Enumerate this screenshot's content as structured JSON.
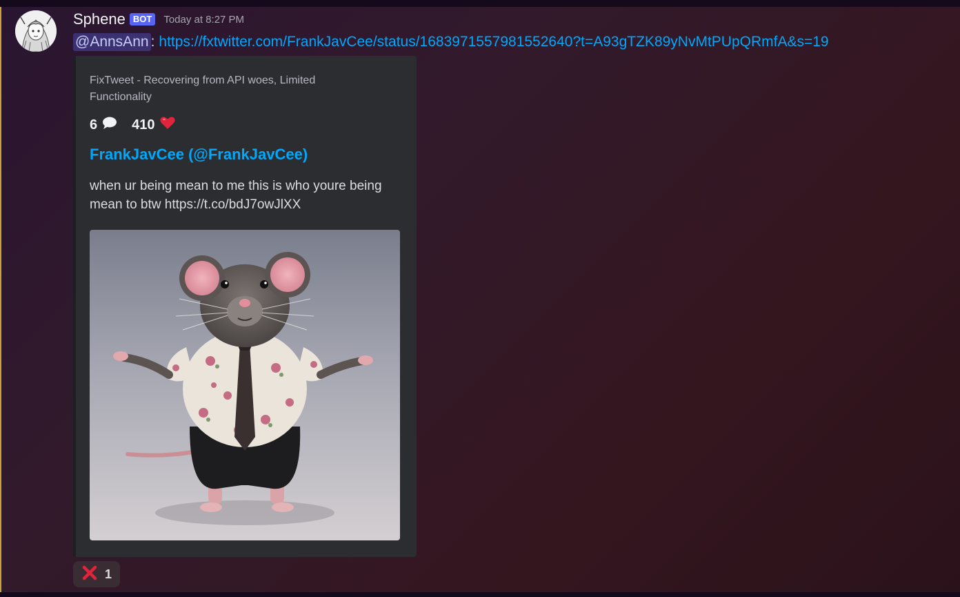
{
  "message": {
    "author": "Sphene",
    "bot_tag": "BOT",
    "timestamp": "Today at 8:27 PM",
    "mention": "@AnnsAnn",
    "separator": ":",
    "link_text": "https://fxtwitter.com/FrankJavCee/status/1683971557981552640?t=A93gTZK89yNvMtPUpQRmfA&s=19"
  },
  "embed": {
    "provider": "FixTweet - Recovering from API woes, Limited Functionality",
    "replies": "6",
    "likes": "410",
    "author": "FrankJavCee (@FrankJavCee)",
    "text": "when ur being mean to me this is who youre being mean to btw https://t.co/bdJ7owJlXX",
    "image_icon": "rat-in-floral-shirt-image"
  },
  "reaction": {
    "emoji_icon": "cross-mark-icon",
    "count": "1"
  },
  "colors": {
    "link": "#00a8fc",
    "bot_tag": "#5865f2",
    "embed_bg": "#2b2d31",
    "mention_bg": "#5865f2"
  }
}
